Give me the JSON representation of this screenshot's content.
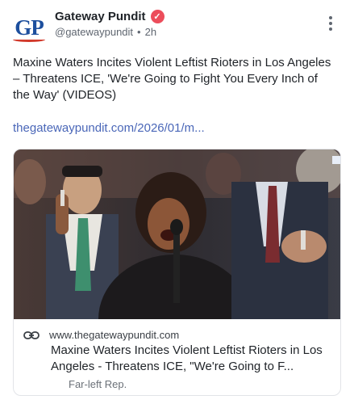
{
  "account": {
    "name": "Gateway Pundit",
    "handle": "@gatewaypundit",
    "separator": "•",
    "time": "2h",
    "avatar_text": "GP",
    "verified_icon": "verified-check-icon"
  },
  "post": {
    "text": "Maxine Waters Incites Violent Leftist Rioters in Los Angeles – Threatens ICE, 'We're Going to Fight You Every Inch of the Way' (VIDEOS)",
    "link_text": "thegatewaypundit.com/2026/01/m..."
  },
  "card": {
    "domain": "www.thegatewaypundit.com",
    "title": "Maxine Waters Incites Violent Leftist Rioters in Los Angeles - Threatens ICE, \"We're Going to F...",
    "subtitle": "Far-left Rep."
  },
  "colors": {
    "accent_link": "#4a67b8",
    "verified_badge": "#ec4d5b",
    "brand_blue": "#1d4f9e"
  }
}
